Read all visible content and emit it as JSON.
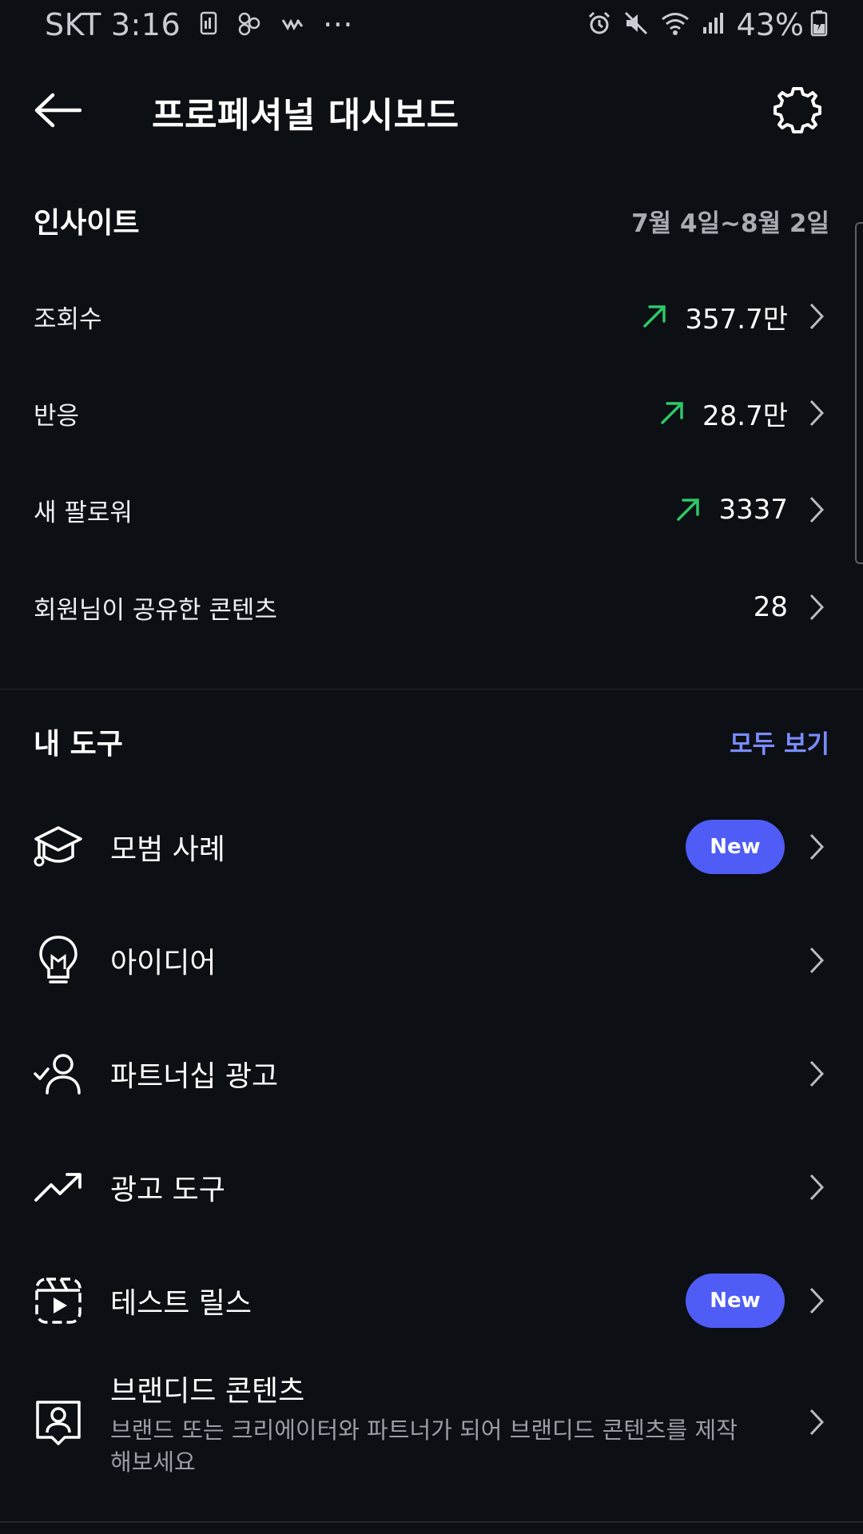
{
  "status_bar": {
    "carrier": "SKT",
    "time": "3:16",
    "more": "···",
    "battery": "43%"
  },
  "header": {
    "title": "프로페셔널 대시보드"
  },
  "insights": {
    "title": "인사이트",
    "date_range": "7월 4일~8월 2일",
    "rows": [
      {
        "label": "조회수",
        "value": "357.7만",
        "trend": "up"
      },
      {
        "label": "반응",
        "value": "28.7만",
        "trend": "up"
      },
      {
        "label": "새 팔로워",
        "value": "3337",
        "trend": "up"
      },
      {
        "label": "회원님이 공유한 콘텐츠",
        "value": "28",
        "trend": "none"
      }
    ]
  },
  "tools": {
    "title": "내 도구",
    "see_all": "모두 보기",
    "items": [
      {
        "label": "모범 사례",
        "icon": "graduation-cap-icon",
        "badge": "New"
      },
      {
        "label": "아이디어",
        "icon": "lightbulb-icon"
      },
      {
        "label": "파트너십 광고",
        "icon": "person-check-icon"
      },
      {
        "label": "광고 도구",
        "icon": "trending-up-icon"
      },
      {
        "label": "테스트 릴스",
        "icon": "reels-icon",
        "badge": "New"
      },
      {
        "label": "브랜디드 콘텐츠",
        "icon": "branded-content-icon",
        "description": "브랜드 또는 크리에이터와 파트너가 되어 브랜디드 콘텐츠를 제작해보세요"
      }
    ]
  },
  "colors": {
    "background": "#0c0f14",
    "trend_up": "#2ec866",
    "accent": "#4f5cf5",
    "link": "#7a8cff"
  }
}
